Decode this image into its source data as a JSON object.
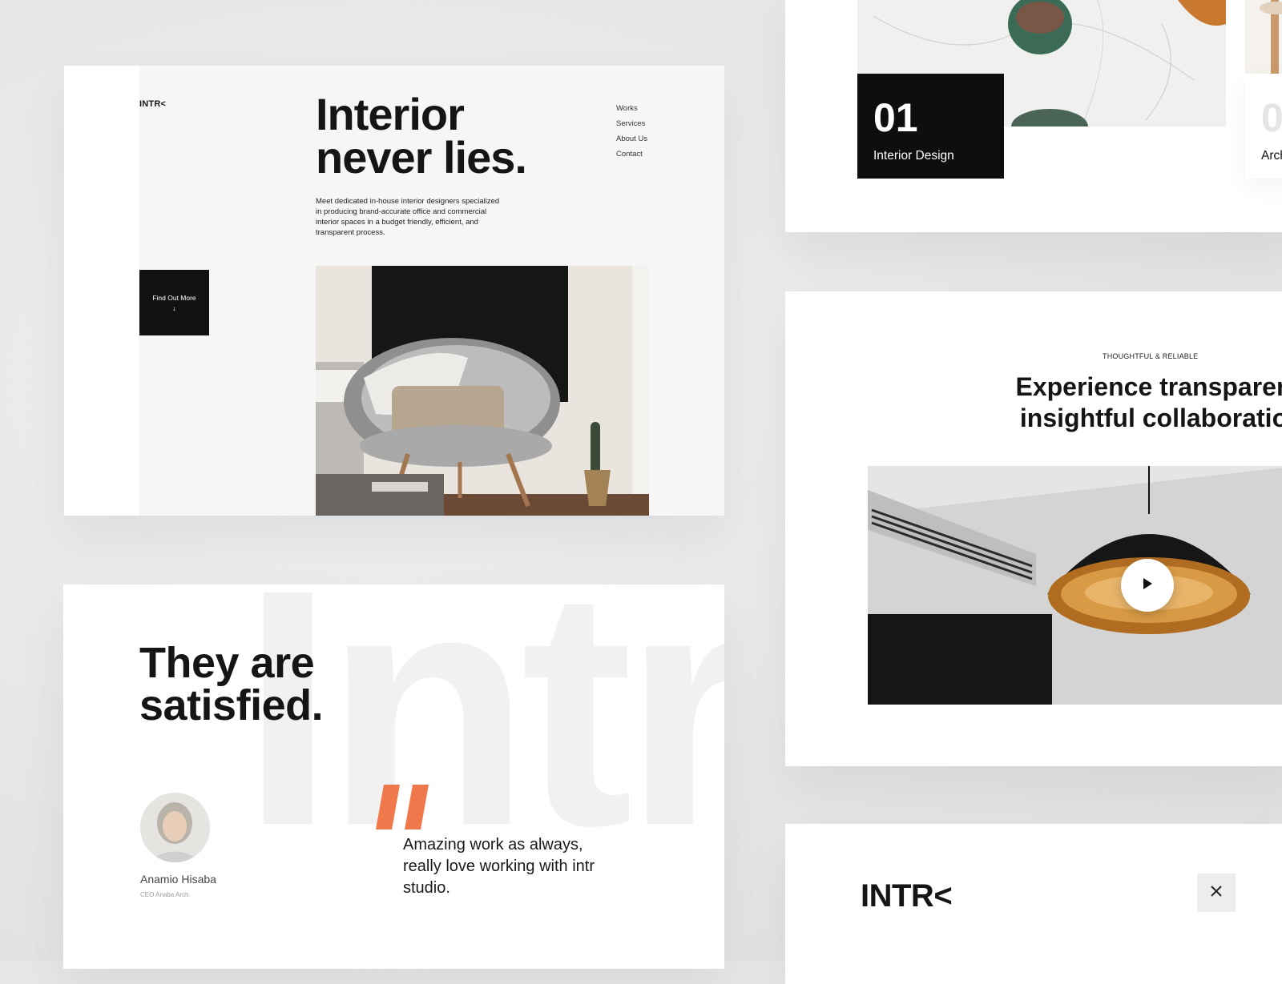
{
  "hero": {
    "logo": "INTR<",
    "title_line1": "Interior",
    "title_line2": "never lies.",
    "description": "Meet dedicated in-house interior designers specialized in producing brand-accurate office and commercial interior spaces in a budget friendly, efficient, and transparent process.",
    "nav": [
      "Works",
      "Services",
      "About Us",
      "Contact"
    ],
    "cta_label": "Find Out More",
    "cta_icon": "arrow-down-icon"
  },
  "services": {
    "items": [
      {
        "number": "01",
        "label": "Interior Design"
      },
      {
        "number": "0",
        "label": "Arch"
      }
    ]
  },
  "testimonial": {
    "background_word": "Intr",
    "title_line1": "They are",
    "title_line2": "satisfied.",
    "name": "Anamio Hisaba",
    "role": "CEO Anaba Arch",
    "quote": "Amazing work as always, really love working with intr studio.",
    "accent_color": "#f0784a"
  },
  "video": {
    "eyebrow": "THOUGHTFUL & RELIABLE",
    "heading_line1": "Experience transparen",
    "heading_line2": "insightful collaboratio",
    "play_icon": "play-icon"
  },
  "menu": {
    "logo": "INTR<",
    "close_icon": "close-icon"
  }
}
